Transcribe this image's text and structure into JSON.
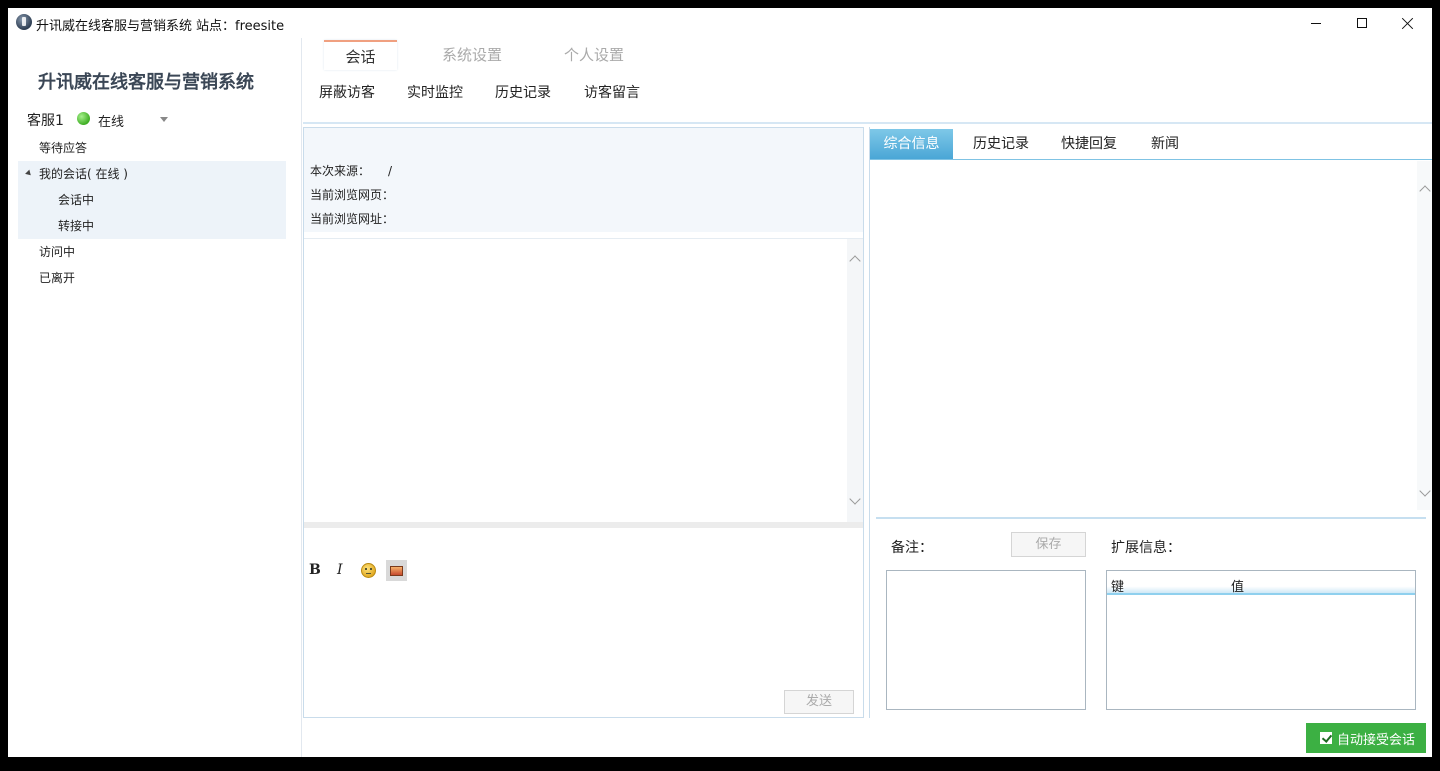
{
  "window": {
    "title": "升讯威在线客服与营销系统",
    "site": "站点：freesite"
  },
  "sidebar": {
    "brand": "升讯威在线客服与营销系统",
    "agent_name": "客服1",
    "status": "在线",
    "status_color": "#3fae24",
    "tree": [
      {
        "label": "等待应答"
      },
      {
        "label": "我的会话( 在线 )"
      },
      {
        "label": "会话中"
      },
      {
        "label": "转接中"
      },
      {
        "label": "访问中"
      },
      {
        "label": "已离开"
      }
    ]
  },
  "main_tabs": [
    {
      "label": "会话"
    },
    {
      "label": "系统设置"
    },
    {
      "label": "个人设置"
    }
  ],
  "toolbar": [
    {
      "label": "屏蔽访客"
    },
    {
      "label": "实时监控"
    },
    {
      "label": "历史记录"
    },
    {
      "label": "访客留言"
    }
  ],
  "visitor_info": {
    "source_label": "本次来源：",
    "source_value": "/",
    "page_label": "当前浏览网页：",
    "url_label": "当前浏览网址："
  },
  "editor": {
    "bold": "B",
    "italic": "I",
    "send": "发送"
  },
  "right_tabs": [
    {
      "label": "综合信息"
    },
    {
      "label": "历史记录"
    },
    {
      "label": "快捷回复"
    },
    {
      "label": "新闻"
    }
  ],
  "notes": {
    "label": "备注：",
    "save": "保存",
    "ext_label": "扩展信息：",
    "col_key": "键",
    "col_value": "值"
  },
  "footer": {
    "auto_accept": "自动接受会话",
    "accent": "#3cb043"
  }
}
